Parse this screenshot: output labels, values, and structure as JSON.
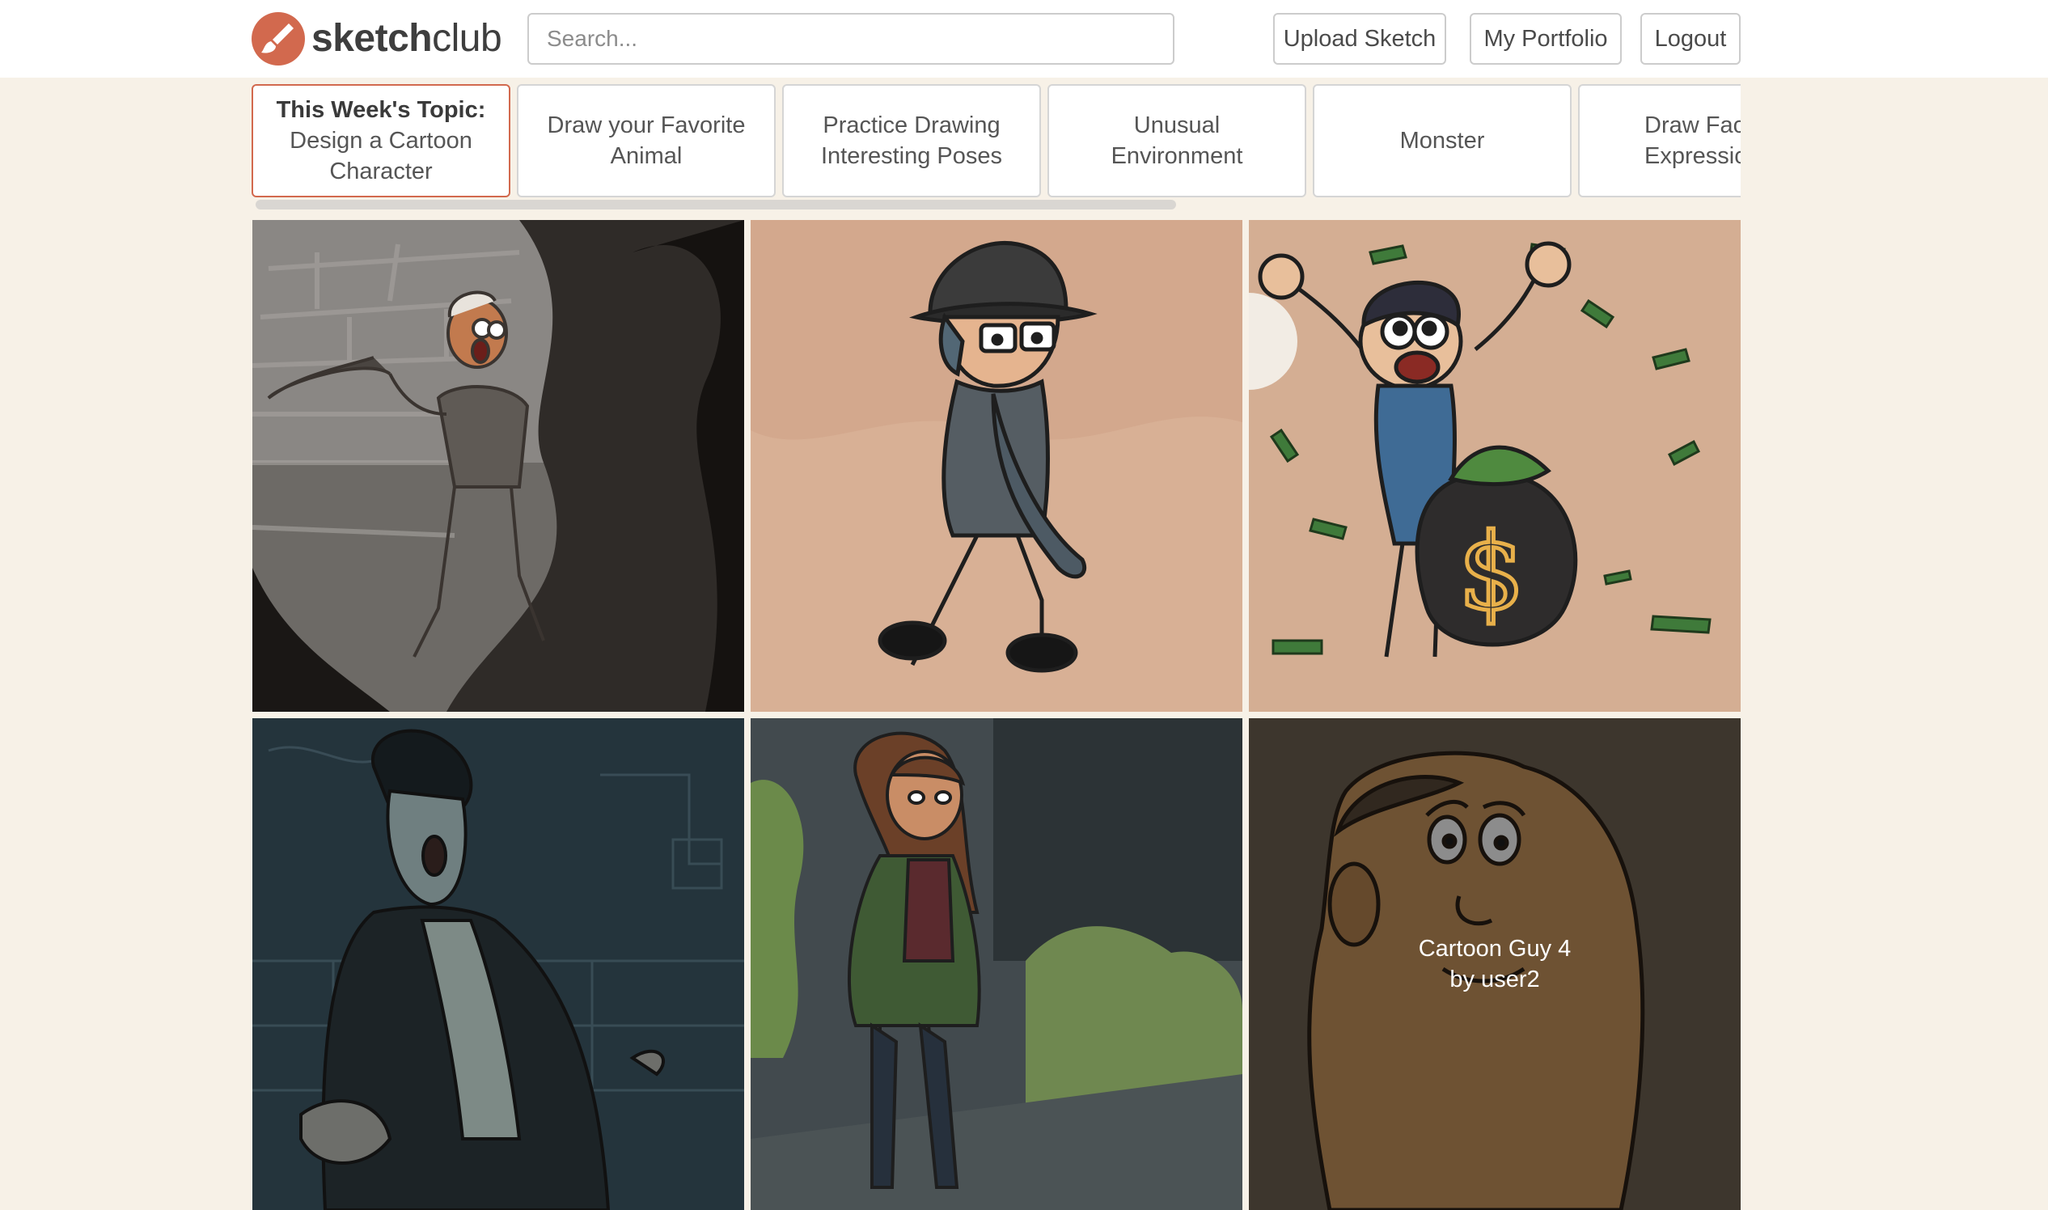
{
  "header": {
    "logo": {
      "bold": "sketch",
      "light": "club"
    },
    "search": {
      "placeholder": "Search..."
    },
    "buttons": {
      "upload": "Upload Sketch",
      "portfolio": "My Portfolio",
      "logout": "Logout"
    },
    "colors": {
      "accent": "#d2694e",
      "background": "#f7f1e7"
    }
  },
  "topics": {
    "active": {
      "heading": "This Week's Topic:",
      "line1": "Design a Cartoon",
      "line2": "Character"
    },
    "items": [
      {
        "line1": "Draw your Favorite",
        "line2": "Animal"
      },
      {
        "line1": "Practice Drawing",
        "line2": "Interesting Poses"
      },
      {
        "line1": "Unusual",
        "line2": "Environment"
      },
      {
        "line1": "Monster",
        "line2": ""
      },
      {
        "line1": "Draw Fac",
        "line2": "Expressic"
      }
    ]
  },
  "gallery": {
    "hover": {
      "title": "Cartoon Guy 4",
      "author": "by user2"
    }
  }
}
